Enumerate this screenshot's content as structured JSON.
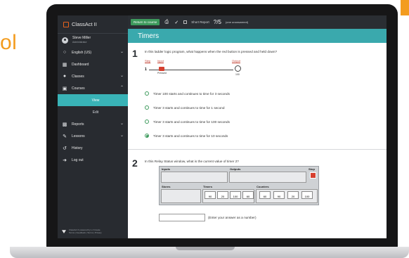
{
  "background_text": "ol",
  "app": {
    "name": "ClassAct II"
  },
  "user": {
    "name": "Steve Miller",
    "role": "Administrator"
  },
  "sidebar": {
    "items": [
      {
        "label": "English (US)",
        "icon": "globe-icon",
        "has_chevron": true
      },
      {
        "label": "Dashboard",
        "icon": "dashboard-icon",
        "has_chevron": false
      },
      {
        "label": "Classes",
        "icon": "users-icon",
        "has_chevron": true
      },
      {
        "label": "Courses",
        "icon": "book-icon",
        "has_chevron": true,
        "expanded": true
      },
      {
        "label": "Reports",
        "icon": "grid-icon",
        "has_chevron": true
      },
      {
        "label": "Lessons",
        "icon": "pencil-icon",
        "has_chevron": true
      },
      {
        "label": "History",
        "icon": "history-icon",
        "has_chevron": false
      },
      {
        "label": "Log out",
        "icon": "logout-icon",
        "has_chevron": false
      }
    ],
    "courses_sub": [
      {
        "label": "View",
        "active": true
      },
      {
        "label": "Edit",
        "active": false
      }
    ],
    "footer_line1": "ClassAct II powered by LJ Create",
    "footer_line2": "Terms | Feedback | Terms | Privacy"
  },
  "toolbar": {
    "return_label": "Return to course",
    "short_report_label": "Short Report",
    "score": "?/5",
    "unanswered": "(one unanswered)"
  },
  "page_title": "Timers",
  "q1": {
    "number": "1",
    "text": "In this ladder logic program, what happens when the red button is pressed and held down?",
    "step_label": "Step",
    "input_label": "Input",
    "output_label": "Output",
    "step_value": "1",
    "pressed_label": "Pressed",
    "timer_value": "100",
    "options": [
      {
        "label": "Timer 100 starts and continues to time for 3 seconds",
        "selected": false
      },
      {
        "label": "Timer 3 starts and continues to time for 1 second",
        "selected": false
      },
      {
        "label": "Timer 3 starts and continues to time for 100 seconds",
        "selected": false
      },
      {
        "label": "Timer 3 starts and continues to time for 10 seconds",
        "selected": true
      }
    ]
  },
  "q2": {
    "number": "2",
    "text": "In this Relay Status window, what is the current value of timer 2?",
    "inputs_label": "Inputs",
    "outputs_label": "Outputs",
    "stop_label": "Stop",
    "stores_label": "Stores",
    "timers_label": "Timers",
    "counters_label": "Counters",
    "timer_values": [
      "90",
      "20",
      "100",
      "60"
    ],
    "counter_values": [
      "60",
      "90",
      "20",
      "100"
    ],
    "answer_placeholder": "",
    "answer_hint": "(Enter your answer as a number)"
  }
}
